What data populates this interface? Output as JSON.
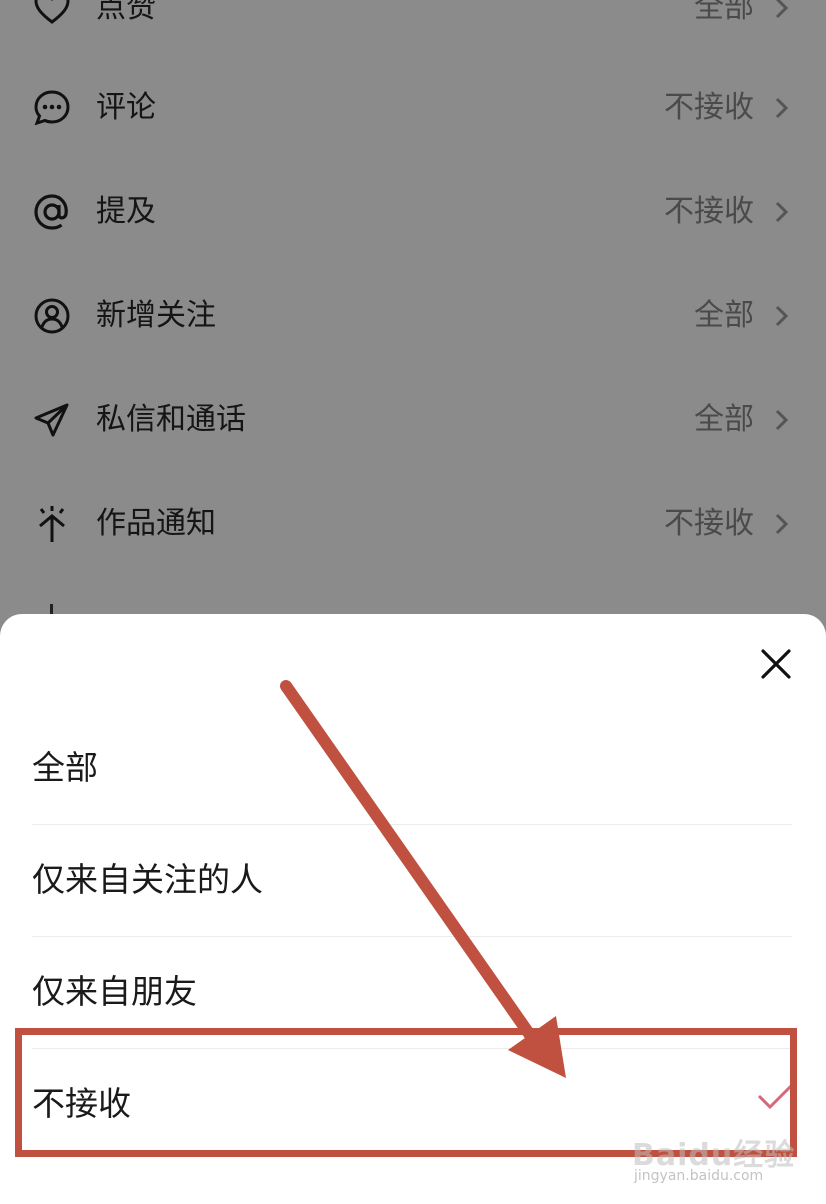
{
  "settings_list": {
    "items": [
      {
        "label": "点赞",
        "value": "全部",
        "icon": "heart-icon"
      },
      {
        "label": "评论",
        "value": "不接收",
        "icon": "comment-icon"
      },
      {
        "label": "提及",
        "value": "不接收",
        "icon": "at-icon"
      },
      {
        "label": "新增关注",
        "value": "全部",
        "icon": "user-circle-icon"
      },
      {
        "label": "私信和通话",
        "value": "全部",
        "icon": "send-icon"
      },
      {
        "label": "作品通知",
        "value": "不接收",
        "icon": "spark-icon"
      }
    ]
  },
  "sheet": {
    "close_icon": "close-icon",
    "options": [
      {
        "label": "全部"
      },
      {
        "label": "仅来自关注的人"
      },
      {
        "label": "仅来自朋友"
      },
      {
        "label": "不接收",
        "selected": true
      }
    ]
  },
  "annotation": {
    "color": "#c0503f"
  },
  "watermark": {
    "brand": "Baidu经验",
    "url": "jingyan.baidu.com"
  }
}
